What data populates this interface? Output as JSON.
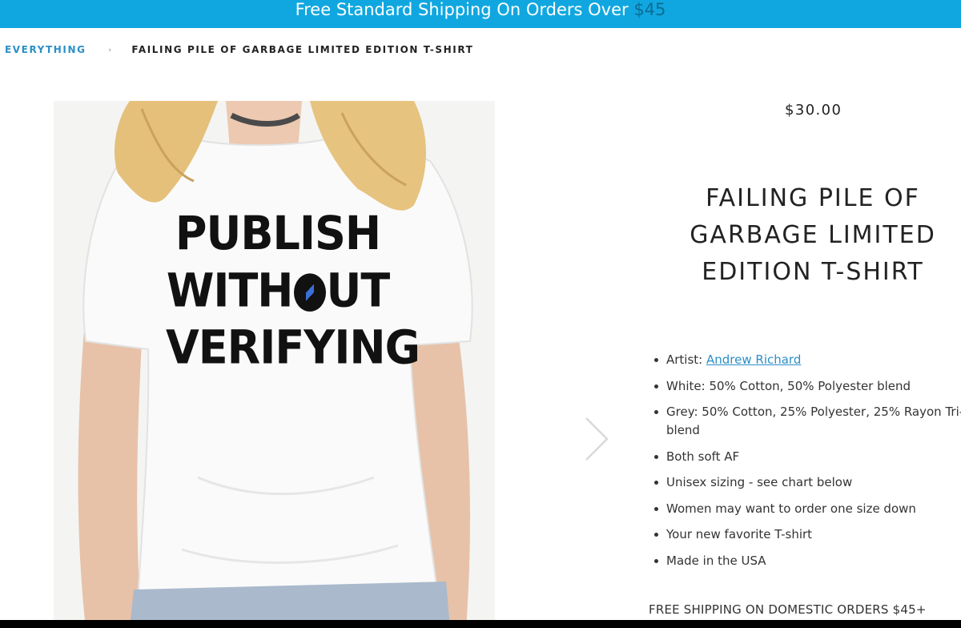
{
  "banner": {
    "text": "Free Standard Shipping On Orders Over ",
    "amount": "$45",
    "color": "#10a7e0"
  },
  "breadcrumb": {
    "root": "EVERYTHING",
    "separator": "›",
    "current": "FAILING PILE OF GARBAGE LIMITED EDITION T-SHIRT"
  },
  "product": {
    "price": "$30.00",
    "title": "FAILING PILE OF GARBAGE LIMITED EDITION T-SHIRT",
    "shirt_print": {
      "line1": "PUBLISH",
      "line2_left": "WITH",
      "line2_right": "UT",
      "line3": "VERIFYING"
    },
    "details": {
      "artist_label": "Artist: ",
      "artist_name": "Andrew Richard",
      "white": "White: 50% Cotton, 50% Polyester blend",
      "grey": "Grey: 50% Cotton, 25% Polyester, 25% Rayon Tri-blend",
      "soft": "Both soft AF",
      "unisex": "Unisex sizing - see chart below",
      "women": "Women may want to order one size down",
      "favorite": "Your new favorite T-shirt",
      "made": "Made in the USA"
    },
    "shipping_note": "FREE SHIPPING ON DOMESTIC ORDERS $45+"
  },
  "icons": {
    "next": "chevron-right-icon"
  }
}
